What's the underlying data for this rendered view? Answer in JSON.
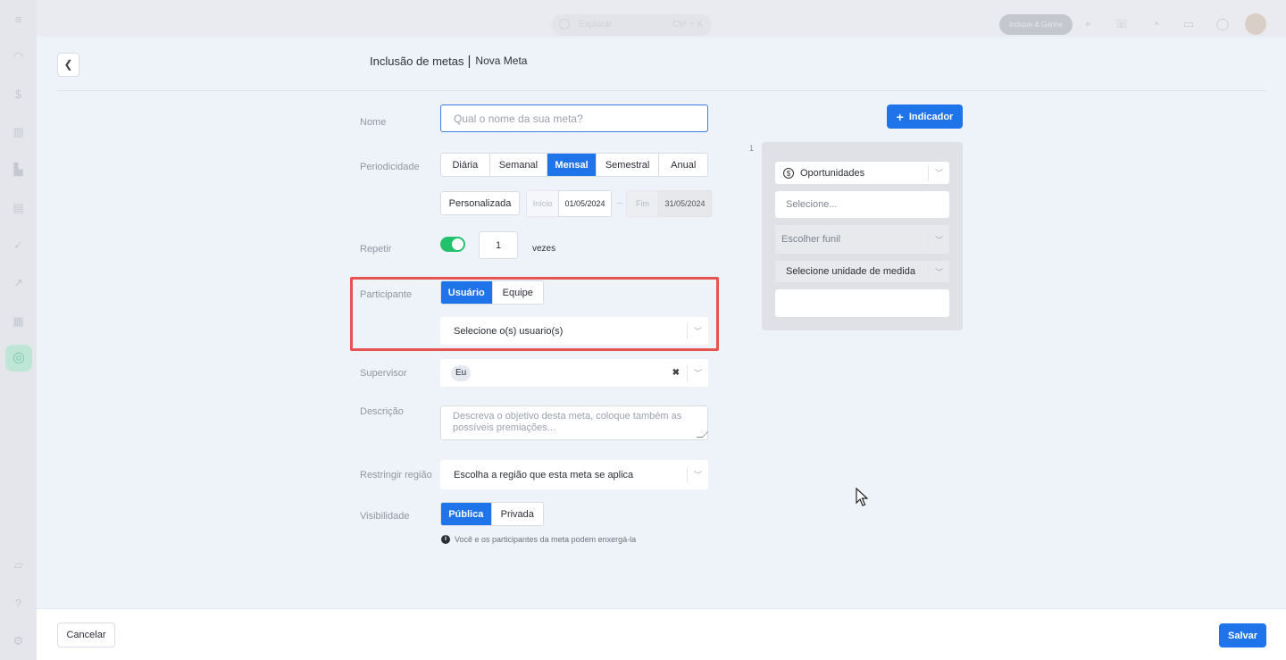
{
  "topbar": {
    "explore_label": "Explorar",
    "explore_shortcut": "Ctrl + K",
    "indique_label": "Indique & Ganhe"
  },
  "page": {
    "title": "Inclusão de metas",
    "separator": "|",
    "subtitle": "Nova Meta"
  },
  "form": {
    "name": {
      "label": "Nome",
      "placeholder": "Qual o nome da sua meta?"
    },
    "periodicity": {
      "label": "Periodicidade",
      "options": [
        "Diária",
        "Semanal",
        "Mensal",
        "Semestral",
        "Anual"
      ],
      "selected": "Mensal",
      "custom_label": "Personalizada",
      "start_caption": "Início",
      "start_value": "01/05/2024",
      "range_dash": "–",
      "end_caption": "Fim",
      "end_value": "31/05/2024"
    },
    "repeat": {
      "label": "Repetir",
      "value": "1",
      "suffix": "vezes"
    },
    "participant": {
      "label": "Participante",
      "options": [
        "Usuário",
        "Equipe"
      ],
      "selected": "Usuário",
      "select_text": "Selecione o(s) usuario(s)"
    },
    "supervisor": {
      "label": "Supervisor",
      "chip": "Eu",
      "clear": "✖"
    },
    "description": {
      "label": "Descrição",
      "placeholder": "Descreva o objetivo desta meta, coloque também as possíveis premiações..."
    },
    "region": {
      "label": "Restringir região",
      "select_text": "Escolha a região que esta meta se aplica"
    },
    "visibility": {
      "label": "Visibilidade",
      "options": [
        "Pública",
        "Privada"
      ],
      "selected": "Pública",
      "info": "Você e os participantes da meta podem enxergá-la"
    }
  },
  "indicator": {
    "add_label": "Indicador",
    "index": "1",
    "type_value": "Oportunidades",
    "select_placeholder": "Selecione...",
    "funnel_placeholder": "Escolher funil",
    "unit_placeholder": "Selecione unidade de medida"
  },
  "footer": {
    "cancel_label": "Cancelar",
    "save_label": "Salvar"
  },
  "colors": {
    "primary": "#1f74ea",
    "toggle_on": "#23c16b",
    "highlight": "#e55353"
  }
}
